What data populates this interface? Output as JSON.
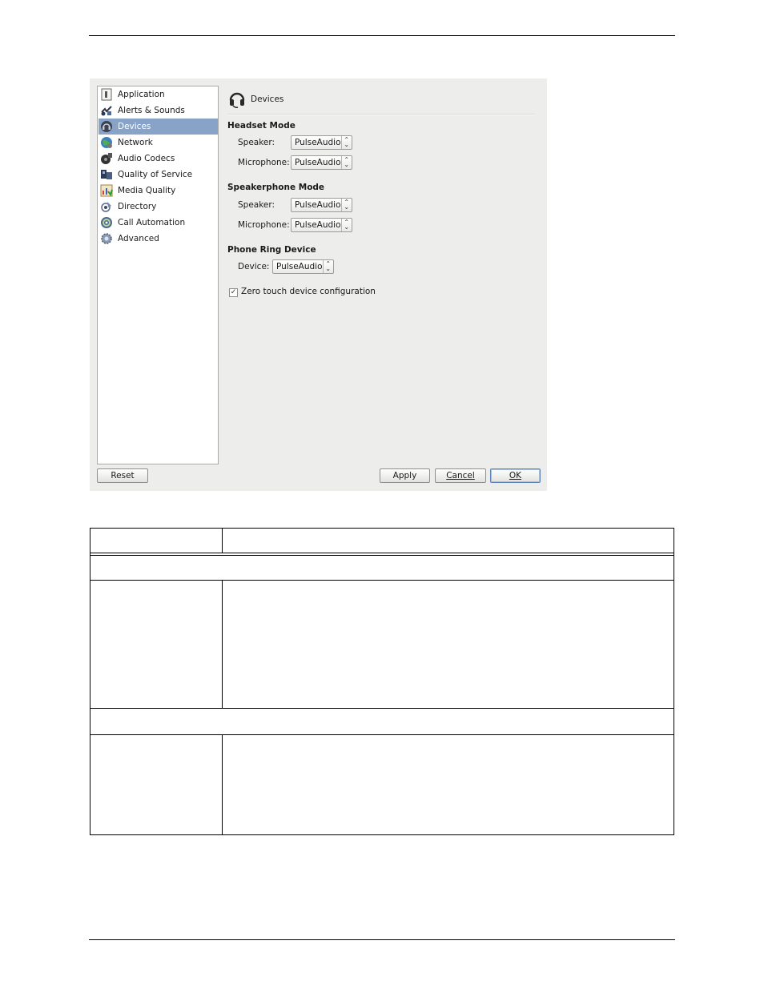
{
  "window": {
    "content_title": "Devices",
    "nav": [
      {
        "label": "Application",
        "icon": "application-icon",
        "selected": false
      },
      {
        "label": "Alerts & Sounds",
        "icon": "alerts-sounds-icon",
        "selected": false
      },
      {
        "label": "Devices",
        "icon": "headset-icon",
        "selected": true
      },
      {
        "label": "Network",
        "icon": "network-globe-icon",
        "selected": false
      },
      {
        "label": "Audio Codecs",
        "icon": "audio-codecs-icon",
        "selected": false
      },
      {
        "label": "Quality of Service",
        "icon": "quality-of-service-icon",
        "selected": false
      },
      {
        "label": "Media Quality",
        "icon": "media-quality-icon",
        "selected": false
      },
      {
        "label": "Directory",
        "icon": "directory-icon",
        "selected": false
      },
      {
        "label": "Call Automation",
        "icon": "call-automation-icon",
        "selected": false
      },
      {
        "label": "Advanced",
        "icon": "advanced-gear-icon",
        "selected": false
      }
    ]
  },
  "headset": {
    "title": "Headset Mode",
    "speaker_label": "Speaker:",
    "speaker_value": "PulseAudio",
    "mic_label": "Microphone:",
    "mic_value": "PulseAudio"
  },
  "speakerphone": {
    "title": "Speakerphone Mode",
    "speaker_label": "Speaker:",
    "speaker_value": "PulseAudio",
    "mic_label": "Microphone:",
    "mic_value": "PulseAudio"
  },
  "ring": {
    "title": "Phone Ring Device",
    "device_label": "Device:",
    "device_value": "PulseAudio"
  },
  "zero_touch": {
    "label": "Zero touch device configuration",
    "checked": true
  },
  "buttons": {
    "reset": "Reset",
    "apply": "Apply",
    "cancel": "Cancel",
    "ok": "OK"
  },
  "colors": {
    "selection": "#88a3c8",
    "dialog_bg": "#ededec"
  }
}
